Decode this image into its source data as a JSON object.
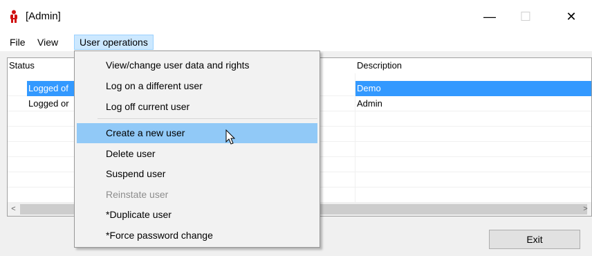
{
  "window": {
    "title": "[Admin]",
    "app_icon": "person-red-icon",
    "controls": {
      "minimize": "—",
      "maximize": "☐",
      "close": "✕"
    }
  },
  "menubar": {
    "file": "File",
    "view": "View",
    "user_operations": "User operations"
  },
  "table": {
    "columns": {
      "status": "Status",
      "description": "Description"
    },
    "rows": [
      {
        "status": "Logged of",
        "description": "Demo",
        "selected": true
      },
      {
        "status": "Logged or",
        "description": "Admin",
        "selected": false
      }
    ]
  },
  "scrollbar": {
    "left_arrow": "<",
    "right_arrow": ">"
  },
  "buttons": {
    "exit": "Exit"
  },
  "dropdown": {
    "items": [
      {
        "label": "View/change user data and rights",
        "state": "normal"
      },
      {
        "label": "Log on a different user",
        "state": "normal"
      },
      {
        "label": "Log off current user",
        "state": "normal"
      },
      {
        "label": "Create a new user",
        "state": "hover"
      },
      {
        "label": "Delete user",
        "state": "normal"
      },
      {
        "label": "Suspend user",
        "state": "normal"
      },
      {
        "label": "Reinstate user",
        "state": "disabled"
      },
      {
        "label": "*Duplicate user",
        "state": "normal"
      },
      {
        "label": "*Force password change",
        "state": "normal"
      }
    ]
  },
  "colors": {
    "selection": "#3399ff",
    "menu_hover": "#91c9f7",
    "menu_active": "#cce8ff",
    "disabled_text": "#8d8d8d"
  }
}
